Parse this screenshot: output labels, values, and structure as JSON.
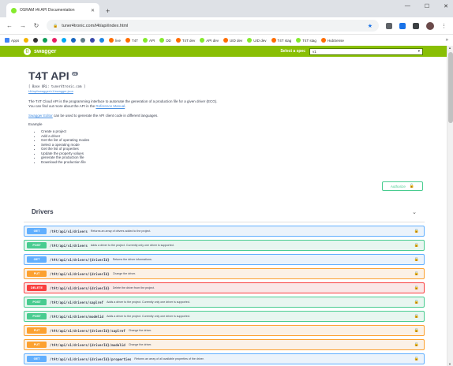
{
  "browser": {
    "tab_title": "OSRAM t4t API Documentation",
    "url": "tuner4tronic.com/t4t/api/index.html",
    "bookmarks": [
      "Apps",
      "live",
      "T4T",
      "API",
      "DD",
      "T4T dev",
      "API dev",
      "UID dev",
      "UID dev",
      "T4T stag",
      "T4T stag",
      "HubSense"
    ]
  },
  "swagger": {
    "logo": "swagger",
    "spec_label": "Select a spec",
    "spec_value": "v1"
  },
  "info": {
    "title": "T4T API",
    "version": "v1",
    "base_url": "[ Base URL: tuner4tronic.com ]",
    "json_link": "t4t/api/swagger/v1/swagger.json",
    "desc1": "The T4T Cloud API is the programming interface to automate the generation of a production file for a given driver (ECG).",
    "desc2_pre": "You can find out more about the API in the",
    "desc2_link": "Reference Manual",
    "swagger_editor_link": "Swagger Editor",
    "swagger_editor_rest": "can be used to generate the API client code in different languages.",
    "example_label": "Example",
    "steps": [
      "Create a project",
      "Add a driver",
      "Get the list of operating modes",
      "Select a operating mode",
      "Get the list of properties",
      "Update the property values",
      "generate the production file",
      "Download the production file"
    ]
  },
  "authorize_label": "Authorize",
  "section": {
    "title": "Drivers",
    "operations": [
      {
        "method": "GET",
        "path": "/t4t/api/v1/drivers",
        "desc": "Returns an array of drivers added to the project."
      },
      {
        "method": "POST",
        "path": "/t4t/api/v1/drivers",
        "desc": "Adds a driver to the project. Currently only one driver is supported."
      },
      {
        "method": "GET",
        "path": "/t4t/api/v1/drivers/{driverId}",
        "desc": "Returns the driver informations."
      },
      {
        "method": "PUT",
        "path": "/t4t/api/v1/drivers/{driverId}",
        "desc": "Change the driver."
      },
      {
        "method": "DELETE",
        "path": "/t4t/api/v1/drivers/{driverId}",
        "desc": "Delete the driver from the project."
      },
      {
        "method": "POST",
        "path": "/t4t/api/v1/drivers/saplref",
        "desc": "Adds a driver to the project. Currently only one driver is supported."
      },
      {
        "method": "POST",
        "path": "/t4t/api/v1/drivers/modelid",
        "desc": "Adds a driver to the project. Currently only one driver is supported."
      },
      {
        "method": "PUT",
        "path": "/t4t/api/v1/drivers/{driverId}/saplref",
        "desc": "Change the driver."
      },
      {
        "method": "PUT",
        "path": "/t4t/api/v1/drivers/{driverId}/modelid",
        "desc": "Change the driver."
      },
      {
        "method": "GET",
        "path": "/t4t/api/v1/drivers/{driverId}/properties",
        "desc": "Returns an array of all available properties of the driver."
      }
    ]
  }
}
